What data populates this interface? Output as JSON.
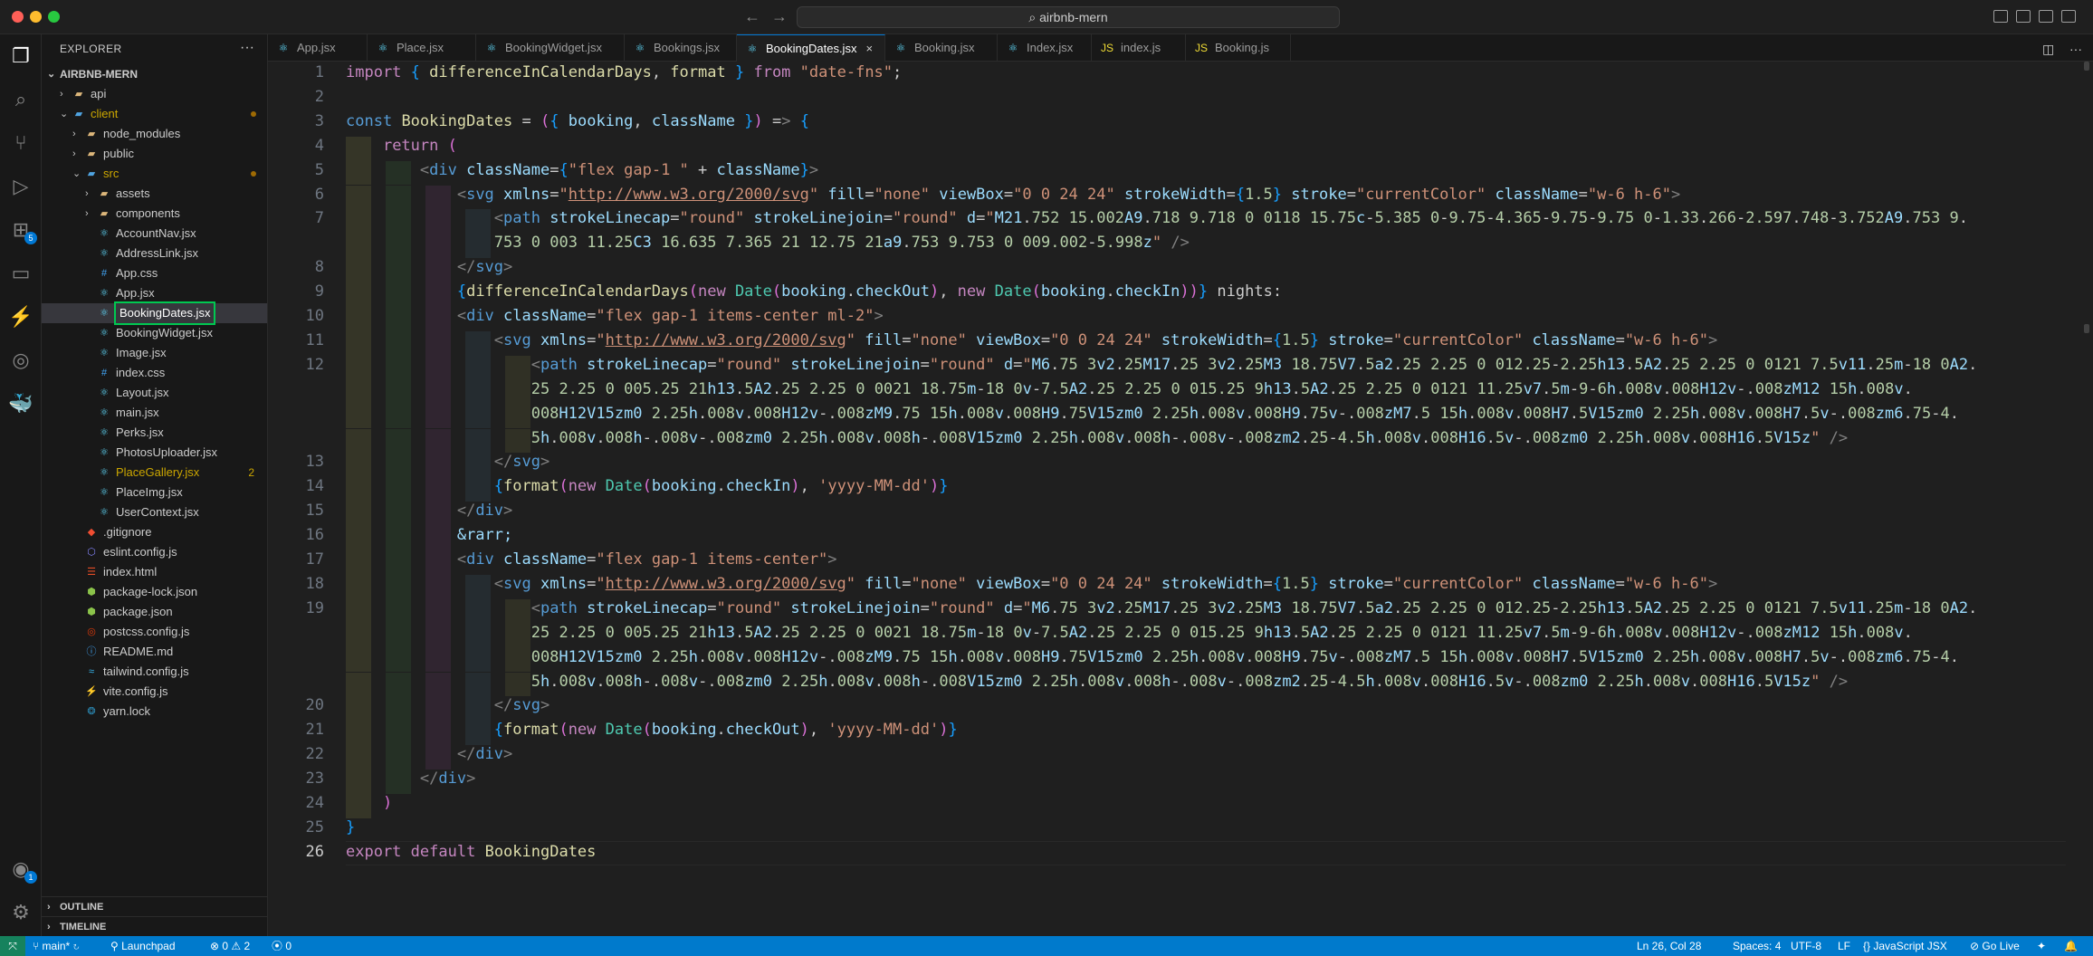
{
  "window": {
    "title": "airbnb-mern"
  },
  "explorer": {
    "title": "EXPLORER",
    "root": "AIRBNB-MERN",
    "items": [
      {
        "label": "api",
        "type": "folder",
        "depth": 1,
        "icon": "folder-icon"
      },
      {
        "label": "client",
        "type": "folder",
        "depth": 1,
        "icon": "folder-icon",
        "color": "#cca700"
      },
      {
        "label": "node_modules",
        "type": "folder",
        "depth": 2,
        "icon": "folder-icon"
      },
      {
        "label": "public",
        "type": "folder",
        "depth": 2,
        "icon": "folder-icon"
      },
      {
        "label": "src",
        "type": "folder",
        "depth": 2,
        "icon": "folder-icon",
        "color": "#cca700"
      },
      {
        "label": "assets",
        "type": "folder",
        "depth": 3,
        "icon": "folder-icon"
      },
      {
        "label": "components",
        "type": "folder",
        "depth": 3,
        "icon": "folder-icon"
      },
      {
        "label": "AccountNav.jsx",
        "type": "file",
        "depth": 3,
        "icon": "react-icon"
      },
      {
        "label": "AddressLink.jsx",
        "type": "file",
        "depth": 3,
        "icon": "react-icon"
      },
      {
        "label": "App.css",
        "type": "file",
        "depth": 3,
        "icon": "css-icon"
      },
      {
        "label": "App.jsx",
        "type": "file",
        "depth": 3,
        "icon": "react-icon"
      },
      {
        "label": "BookingDates.jsx",
        "type": "file",
        "depth": 3,
        "icon": "react-icon",
        "selected": true
      },
      {
        "label": "BookingWidget.jsx",
        "type": "file",
        "depth": 3,
        "icon": "react-icon"
      },
      {
        "label": "Image.jsx",
        "type": "file",
        "depth": 3,
        "icon": "react-icon"
      },
      {
        "label": "index.css",
        "type": "file",
        "depth": 3,
        "icon": "css-icon"
      },
      {
        "label": "Layout.jsx",
        "type": "file",
        "depth": 3,
        "icon": "react-icon"
      },
      {
        "label": "main.jsx",
        "type": "file",
        "depth": 3,
        "icon": "react-icon"
      },
      {
        "label": "Perks.jsx",
        "type": "file",
        "depth": 3,
        "icon": "react-icon"
      },
      {
        "label": "PhotosUploader.jsx",
        "type": "file",
        "depth": 3,
        "icon": "react-icon"
      },
      {
        "label": "PlaceGallery.jsx",
        "type": "file",
        "depth": 3,
        "icon": "react-icon",
        "color": "#cca700",
        "badge": "2"
      },
      {
        "label": "PlaceImg.jsx",
        "type": "file",
        "depth": 3,
        "icon": "react-icon"
      },
      {
        "label": "UserContext.jsx",
        "type": "file",
        "depth": 3,
        "icon": "react-icon"
      },
      {
        "label": ".gitignore",
        "type": "file",
        "depth": 2,
        "icon": "git-icon"
      },
      {
        "label": "eslint.config.js",
        "type": "file",
        "depth": 2,
        "icon": "eslint-icon"
      },
      {
        "label": "index.html",
        "type": "file",
        "depth": 2,
        "icon": "html-icon"
      },
      {
        "label": "package-lock.json",
        "type": "file",
        "depth": 2,
        "icon": "node-icon"
      },
      {
        "label": "package.json",
        "type": "file",
        "depth": 2,
        "icon": "node-icon"
      },
      {
        "label": "postcss.config.js",
        "type": "file",
        "depth": 2,
        "icon": "postcss-icon"
      },
      {
        "label": "README.md",
        "type": "file",
        "depth": 2,
        "icon": "info-icon"
      },
      {
        "label": "tailwind.config.js",
        "type": "file",
        "depth": 2,
        "icon": "tailwind-icon"
      },
      {
        "label": "vite.config.js",
        "type": "file",
        "depth": 2,
        "icon": "vite-icon"
      },
      {
        "label": "yarn.lock",
        "type": "file",
        "depth": 2,
        "icon": "yarn-icon"
      }
    ],
    "outline": "OUTLINE",
    "timeline": "TIMELINE"
  },
  "tabs": [
    {
      "label": "App.jsx",
      "icon": "react-icon"
    },
    {
      "label": "Place.jsx",
      "icon": "react-icon"
    },
    {
      "label": "BookingWidget.jsx",
      "icon": "react-icon"
    },
    {
      "label": "Bookings.jsx",
      "icon": "react-icon"
    },
    {
      "label": "BookingDates.jsx",
      "icon": "react-icon",
      "active": true
    },
    {
      "label": "Booking.jsx",
      "icon": "react-icon"
    },
    {
      "label": "Index.jsx",
      "icon": "react-icon"
    },
    {
      "label": "index.js",
      "icon": "js-icon"
    },
    {
      "label": "Booking.js",
      "icon": "js-icon"
    }
  ],
  "editor": {
    "current_line": 26,
    "lines": [
      {
        "n": "1",
        "text": "import { differenceInCalendarDays, format } from \"date-fns\";"
      },
      {
        "n": "2",
        "text": ""
      },
      {
        "n": "3",
        "text": "const BookingDates = ({ booking, className }) => {"
      },
      {
        "n": "4",
        "text": "    return ("
      },
      {
        "n": "5",
        "text": "        <div className={\"flex gap-1 \" + className}>"
      },
      {
        "n": "6",
        "text": "            <svg xmlns=\"http://www.w3.org/2000/svg\" fill=\"none\" viewBox=\"0 0 24 24\" strokeWidth={1.5} stroke=\"currentColor\" className=\"w-6 h-6\">"
      },
      {
        "n": "7",
        "text": "                <path strokeLinecap=\"round\" strokeLinejoin=\"round\" d=\"M21.752 15.002A9.718 9.718 0 0118 15.75c-5.385 0-9.75-4.365-9.75-9.75 0-1.33.266-2.597.748-3.752A9.753 9."
      },
      {
        "n": "",
        "text": "                753 0 003 11.25C3 16.635 7.365 21 12.75 21a9.753 9.753 0 009.002-5.998z\" />"
      },
      {
        "n": "8",
        "text": "            </svg>"
      },
      {
        "n": "9",
        "text": "            {differenceInCalendarDays(new Date(booking.checkOut), new Date(booking.checkIn))} nights:"
      },
      {
        "n": "10",
        "text": "            <div className=\"flex gap-1 items-center ml-2\">"
      },
      {
        "n": "11",
        "text": "                <svg xmlns=\"http://www.w3.org/2000/svg\" fill=\"none\" viewBox=\"0 0 24 24\" strokeWidth={1.5} stroke=\"currentColor\" className=\"w-6 h-6\">"
      },
      {
        "n": "12",
        "text": "                    <path strokeLinecap=\"round\" strokeLinejoin=\"round\" d=\"M6.75 3v2.25M17.25 3v2.25M3 18.75V7.5a2.25 2.25 0 012.25-2.25h13.5A2.25 2.25 0 0121 7.5v11.25m-18 0A2."
      },
      {
        "n": "",
        "text": "                    25 2.25 0 005.25 21h13.5A2.25 2.25 0 0021 18.75m-18 0v-7.5A2.25 2.25 0 015.25 9h13.5A2.25 2.25 0 0121 11.25v7.5m-9-6h.008v.008H12v-.008zM12 15h.008v."
      },
      {
        "n": "",
        "text": "                    008H12V15zm0 2.25h.008v.008H12v-.008zM9.75 15h.008v.008H9.75V15zm0 2.25h.008v.008H9.75v-.008zM7.5 15h.008v.008H7.5V15zm0 2.25h.008v.008H7.5v-.008zm6.75-4."
      },
      {
        "n": "",
        "text": "                    5h.008v.008h-.008v-.008zm0 2.25h.008v.008h-.008V15zm0 2.25h.008v.008h-.008v-.008zm2.25-4.5h.008v.008H16.5v-.008zm0 2.25h.008v.008H16.5V15z\" />"
      },
      {
        "n": "13",
        "text": "                </svg>"
      },
      {
        "n": "14",
        "text": "                {format(new Date(booking.checkIn), 'yyyy-MM-dd')}"
      },
      {
        "n": "15",
        "text": "            </div>"
      },
      {
        "n": "16",
        "text": "            &rarr;"
      },
      {
        "n": "17",
        "text": "            <div className=\"flex gap-1 items-center\">"
      },
      {
        "n": "18",
        "text": "                <svg xmlns=\"http://www.w3.org/2000/svg\" fill=\"none\" viewBox=\"0 0 24 24\" strokeWidth={1.5} stroke=\"currentColor\" className=\"w-6 h-6\">"
      },
      {
        "n": "19",
        "text": "                    <path strokeLinecap=\"round\" strokeLinejoin=\"round\" d=\"M6.75 3v2.25M17.25 3v2.25M3 18.75V7.5a2.25 2.25 0 012.25-2.25h13.5A2.25 2.25 0 0121 7.5v11.25m-18 0A2."
      },
      {
        "n": "",
        "text": "                    25 2.25 0 005.25 21h13.5A2.25 2.25 0 0021 18.75m-18 0v-7.5A2.25 2.25 0 015.25 9h13.5A2.25 2.25 0 0121 11.25v7.5m-9-6h.008v.008H12v-.008zM12 15h.008v."
      },
      {
        "n": "",
        "text": "                    008H12V15zm0 2.25h.008v.008H12v-.008zM9.75 15h.008v.008H9.75V15zm0 2.25h.008v.008H9.75v-.008zM7.5 15h.008v.008H7.5V15zm0 2.25h.008v.008H7.5v-.008zm6.75-4."
      },
      {
        "n": "",
        "text": "                    5h.008v.008h-.008v-.008zm0 2.25h.008v.008h-.008V15zm0 2.25h.008v.008h-.008v-.008zm2.25-4.5h.008v.008H16.5v-.008zm0 2.25h.008v.008H16.5V15z\" />"
      },
      {
        "n": "20",
        "text": "                </svg>"
      },
      {
        "n": "21",
        "text": "                {format(new Date(booking.checkOut), 'yyyy-MM-dd')}"
      },
      {
        "n": "22",
        "text": "            </div>"
      },
      {
        "n": "23",
        "text": "        </div>"
      },
      {
        "n": "24",
        "text": "    )"
      },
      {
        "n": "25",
        "text": "}"
      },
      {
        "n": "26",
        "text": "export default BookingDates"
      }
    ]
  },
  "activity_bar": {
    "items": [
      "files-icon",
      "search-icon",
      "source-control-icon",
      "run-debug-icon",
      "extensions-icon",
      "remote-explorer-icon",
      "testing-icon",
      "gitlens-icon",
      "docker-icon"
    ],
    "extensions_badge": "5",
    "account_badge": "1"
  },
  "statusbar": {
    "branch": "main*",
    "launchpad": "Launchpad",
    "errors": "0",
    "warnings": "2",
    "ports": "0",
    "position": "Ln 26, Col 28",
    "spaces": "Spaces: 4",
    "encoding": "UTF-8",
    "eol": "LF",
    "language": "JavaScript JSX",
    "golive": "Go Live"
  }
}
